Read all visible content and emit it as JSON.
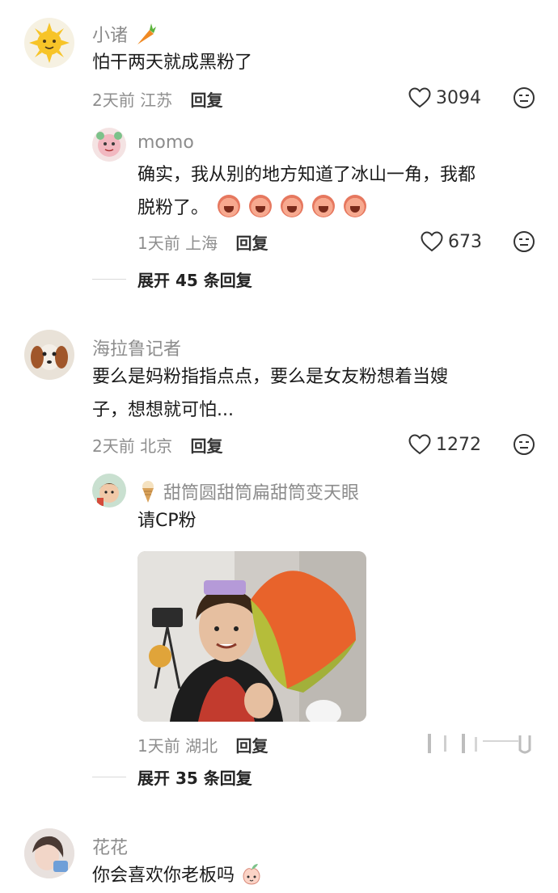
{
  "comments": [
    {
      "username": "小诸",
      "username_emoji": "carrot-icon",
      "text_lines": [
        "怕干两天就成黑粉了"
      ],
      "time": "2天前",
      "location": "江苏",
      "reply_label": "回复",
      "likes": "3094"
    },
    {
      "username": "海拉鲁记者",
      "text_lines": [
        "要么是妈粉指指点点，要么是女友粉想着当嫂",
        "子，想想就可怕..."
      ],
      "time": "2天前",
      "location": "北京",
      "reply_label": "回复",
      "likes": "1272"
    },
    {
      "username": "花花",
      "text_lines": [
        "你会喜欢你老板吗"
      ],
      "text_emoji": "peach-face-icon"
    }
  ],
  "replies": [
    {
      "username": "momo",
      "text_lines": [
        "确实，我从别的地方知道了冰山一角，我都",
        "脱粉了。"
      ],
      "emoji_count": 5,
      "time": "1天前",
      "location": "上海",
      "reply_label": "回复",
      "likes": "673",
      "expand_label": "展开 45 条回复"
    },
    {
      "username": "甜筒圆甜筒扁甜筒变天眼",
      "username_icon": "ice-cream-icon",
      "text_lines": [
        "请CP粉"
      ],
      "time": "1天前",
      "location": "湖北",
      "reply_label": "回复",
      "expand_label": "展开 35 条回复"
    }
  ],
  "colors": {
    "username": "#8c8c8c",
    "text": "#1a1a1a",
    "meta": "#8e8e8e",
    "background": "#ffffff"
  }
}
